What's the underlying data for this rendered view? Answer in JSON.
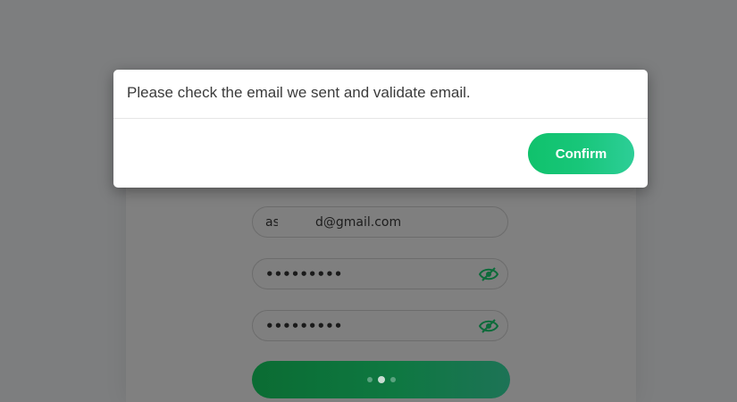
{
  "background": {
    "overlay_color": "#7d7e7f"
  },
  "form": {
    "email_value_prefix": "as",
    "email_value_suffix": "d@gmail.com",
    "password_value": "•••••••••",
    "confirm_password_value": "•••••••••",
    "password_toggle_icon": "eye-icon",
    "submit_state": "loading"
  },
  "dialog": {
    "message": "Please check the email we sent and validate email.",
    "confirm_label": "Confirm",
    "accent_color": "#1ac47a"
  }
}
